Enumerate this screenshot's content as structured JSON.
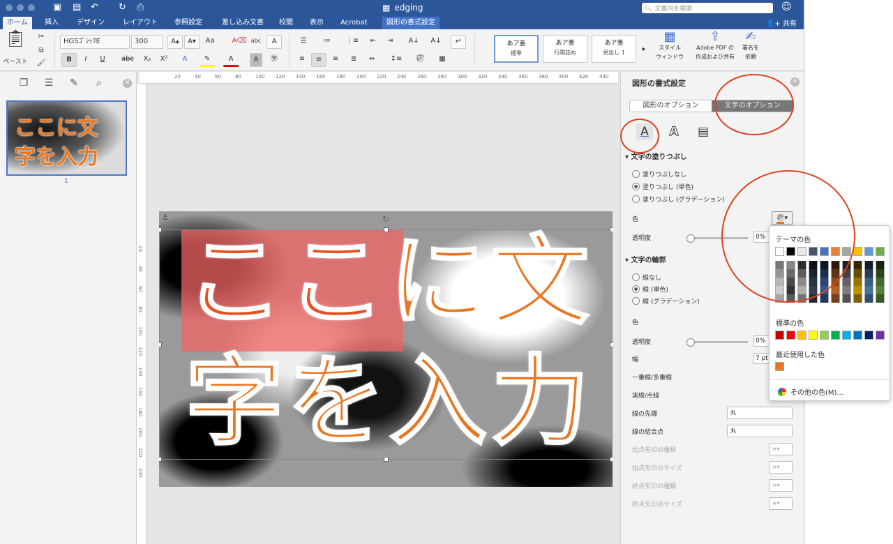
{
  "window": {
    "title": "edging",
    "search_placeholder": "文書内を検索"
  },
  "tabs": [
    "ホーム",
    "挿入",
    "デザイン",
    "レイアウト",
    "参照設定",
    "差し込み文書",
    "校閲",
    "表示",
    "Acrobat",
    "図形の書式設定"
  ],
  "share_label": "共有",
  "ribbon": {
    "paste_label": "ペースト",
    "font_name": "HGSｺﾞｼｯｸE",
    "font_size": "300",
    "styles": [
      {
        "preview": "あア亜",
        "label": "標準"
      },
      {
        "preview": "あア亜",
        "label": "行間詰め"
      },
      {
        "preview": "あア亜",
        "label": "見出し 1"
      }
    ],
    "style_window_label": "スタイル\nウィンドウ",
    "adobe_label": "Adobe PDF の\n作成および共有",
    "sign_label": "署名を\n依頼"
  },
  "thumbnail": {
    "line1": "ここに文",
    "line2": "字を入力",
    "page_number": "1"
  },
  "ruler_ticks": [
    "20",
    "40",
    "60",
    "80",
    "100",
    "120",
    "140",
    "160",
    "180",
    "200",
    "220",
    "240",
    "260",
    "280",
    "300",
    "320",
    "340",
    "360",
    "380",
    "400",
    "420",
    "440"
  ],
  "ruler_left_ticks": [
    "20",
    "40",
    "60",
    "80",
    "100",
    "120",
    "140",
    "160",
    "180",
    "200",
    "220",
    "240"
  ],
  "slide": {
    "line1_highlight": "ここ",
    "line1_rest": "に文",
    "line2": "字を入力"
  },
  "panel": {
    "title": "図形の書式設定",
    "tabs": [
      "図形のオプション",
      "文字のオプション"
    ],
    "fill_section": "文字の塗りつぶし",
    "fill_options": [
      "塗りつぶしなし",
      "塗りつぶし (単色)",
      "塗りつぶし (グラデーション)"
    ],
    "color_label": "色",
    "transparency_label": "透明度",
    "transparency_value": "0%",
    "outline_section": "文字の輪郭",
    "outline_options": [
      "線なし",
      "線 (単色)",
      "線 (グラデーション)"
    ],
    "outline_color_label": "色",
    "outline_transparency_label": "透明度",
    "outline_transparency_value": "0%",
    "width_label": "幅",
    "width_value": "7 pt",
    "compound_label": "一重線/多重線",
    "dash_label": "実線/点線",
    "cap_label": "線の先端",
    "cap_value": "丸",
    "join_label": "線の結合点",
    "join_value": "丸",
    "arrow_begin_type": "始点矢印の種類",
    "arrow_begin_size": "始点矢印のサイズ",
    "arrow_end_type": "終点矢印の種類",
    "arrow_end_size": "終点矢印のサイズ"
  },
  "color_popup": {
    "theme_label": "テーマの色",
    "standard_label": "標準の色",
    "recent_label": "最近使用した色",
    "more_label": "その他の色(M)...",
    "theme_colors": [
      "#ffffff",
      "#000000",
      "#e7e6e6",
      "#44546a",
      "#4472c4",
      "#ed7d31",
      "#a5a5a5",
      "#ffc000",
      "#5b9bd5",
      "#70ad47"
    ],
    "standard_colors": [
      "#c00000",
      "#ff0000",
      "#ffc000",
      "#ffff00",
      "#92d050",
      "#00b050",
      "#00b0f0",
      "#0070c0",
      "#002060",
      "#7030a0"
    ],
    "recent_colors": [
      "#e87722"
    ]
  }
}
